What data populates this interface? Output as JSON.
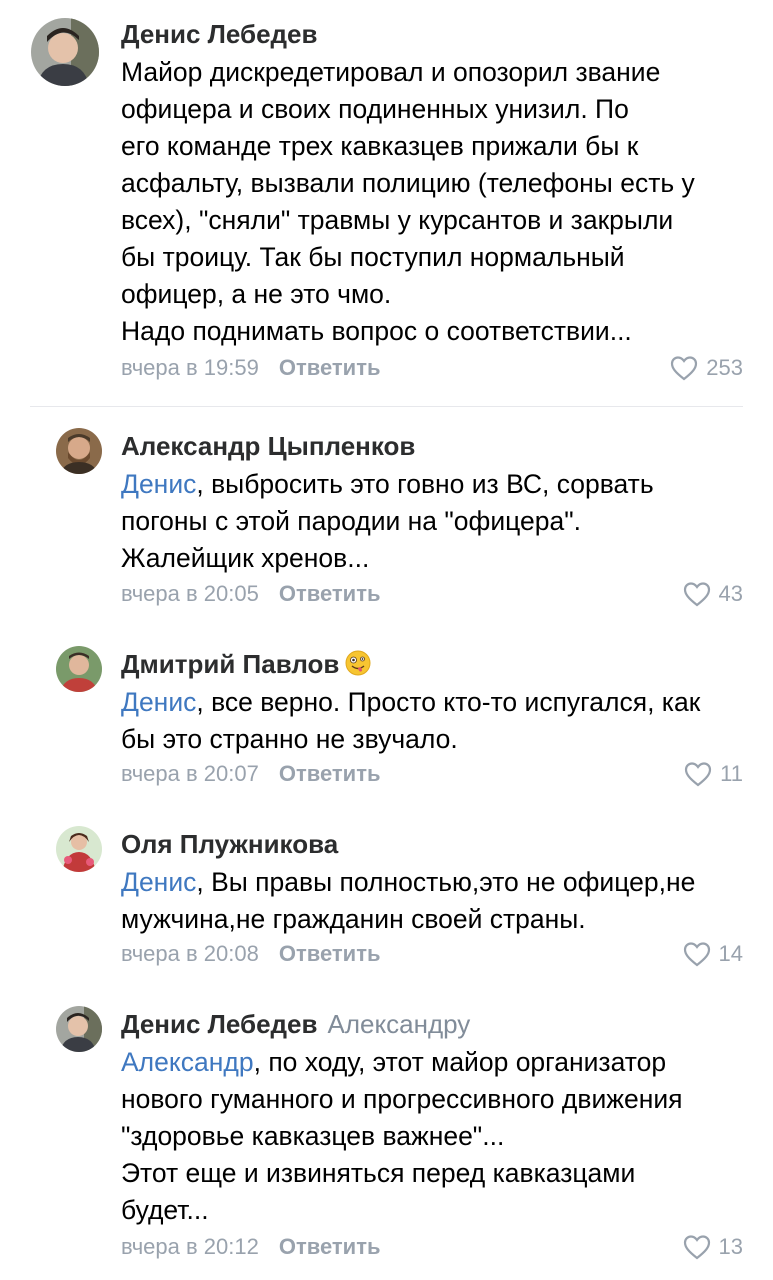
{
  "reply_label": "Ответить",
  "comments": [
    {
      "author": "Денис Лебедев",
      "lines": [
        "Майор дискредетировал и опозорил звание",
        "офицера и своих подиненных унизил. По",
        "его команде трех кавказцев прижали бы к",
        "асфальту, вызвали полицию (телефоны есть у",
        "всех), \"сняли\" травмы у курсантов и закрыли",
        "бы троицу. Так бы поступил нормальный",
        "офицер, а не это чмо.",
        "Надо поднимать вопрос о соответствии..."
      ],
      "time": "вчера в 19:59",
      "likes": "253"
    },
    {
      "author": "Александр Цыпленков",
      "mention": "Денис",
      "first_rest": ", выбросить это говно из ВС, сорвать",
      "lines": [
        "погоны с этой пародии на \"офицера\".",
        "Жалейщик хренов..."
      ],
      "time": "вчера в 20:05",
      "likes": "43"
    },
    {
      "author": "Дмитрий Павлов",
      "emoji": "zany-face-emoji",
      "mention": "Денис",
      "first_rest": ", все верно. Просто кто-то испугался, как",
      "lines": [
        "бы это странно не звучало."
      ],
      "time": "вчера в 20:07",
      "likes": "11"
    },
    {
      "author": "Оля Плужникова",
      "mention": "Денис",
      "first_rest": ", Вы правы полностью,это не офицер,не",
      "lines": [
        "мужчина,не гражданин своей страны."
      ],
      "time": "вчера в 20:08",
      "likes": "14"
    },
    {
      "author": "Денис Лебедев",
      "reply_to": "Александру",
      "mention": "Александр",
      "first_rest": ", по ходу, этот майор организатор",
      "lines": [
        "нового гуманного и прогрессивного  движения",
        "\"здоровье кавказцев важнее\"...",
        "Этот еще и извиняться перед кавказцами",
        "будет..."
      ],
      "time": "вчера в 20:12",
      "likes": "13"
    }
  ],
  "icons": {
    "like": "heart-outline-icon"
  },
  "colors": {
    "mention": "#3f78c0",
    "meta": "#99a2ad",
    "author": "#2c2d2e",
    "reply_to": "#818c99"
  }
}
